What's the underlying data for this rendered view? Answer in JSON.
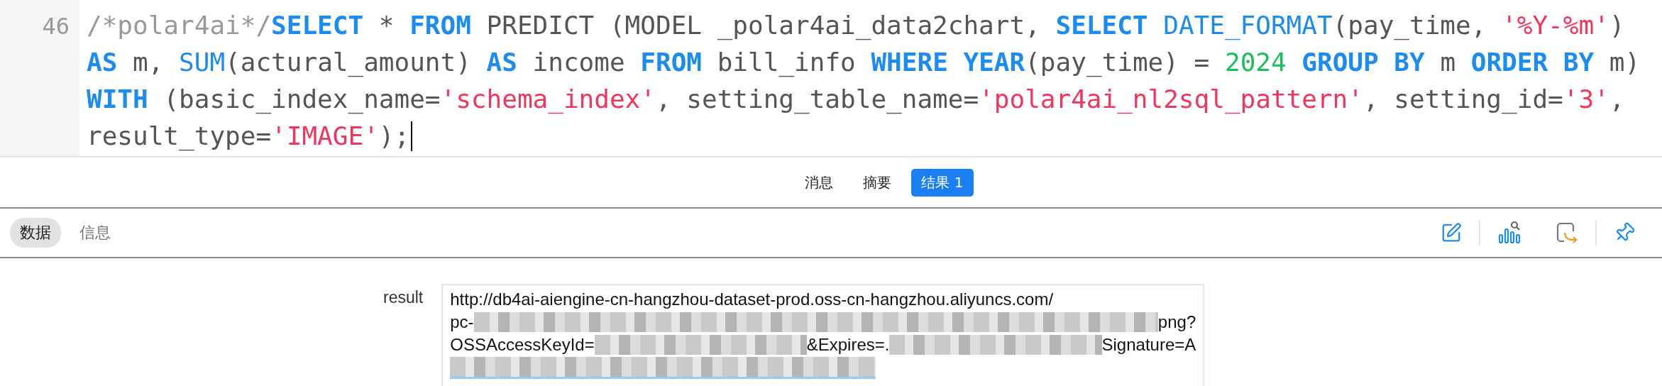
{
  "editor": {
    "line_number": "46",
    "lines": [
      [
        {
          "kind": "comment",
          "text": "/*polar4ai*/"
        },
        {
          "kind": "keyword",
          "text": "SELECT"
        },
        {
          "kind": "plain",
          "text": " * "
        },
        {
          "kind": "keyword",
          "text": "FROM"
        },
        {
          "kind": "plain",
          "text": " PREDICT (MODEL _polar4ai_data2chart, "
        },
        {
          "kind": "keyword",
          "text": "SELECT"
        },
        {
          "kind": "func",
          "text": " DATE_FORMAT"
        },
        {
          "kind": "plain",
          "text": "(pay_time, "
        },
        {
          "kind": "string",
          "text": "'%Y-%m'"
        },
        {
          "kind": "plain",
          "text": ")"
        }
      ],
      [
        {
          "kind": "keyword",
          "text": "AS"
        },
        {
          "kind": "plain",
          "text": " m, "
        },
        {
          "kind": "func",
          "text": "SUM"
        },
        {
          "kind": "plain",
          "text": "(actural_amount) "
        },
        {
          "kind": "keyword",
          "text": "AS"
        },
        {
          "kind": "plain",
          "text": " income "
        },
        {
          "kind": "keyword",
          "text": "FROM"
        },
        {
          "kind": "plain",
          "text": " bill_info "
        },
        {
          "kind": "keyword",
          "text": "WHERE YEAR"
        },
        {
          "kind": "plain",
          "text": "(pay_time) = "
        },
        {
          "kind": "number",
          "text": "2024"
        },
        {
          "kind": "keyword",
          "text": " GROUP BY"
        },
        {
          "kind": "plain",
          "text": " m "
        },
        {
          "kind": "keyword",
          "text": "ORDER BY"
        },
        {
          "kind": "plain",
          "text": " m)"
        }
      ],
      [
        {
          "kind": "keyword",
          "text": "WITH"
        },
        {
          "kind": "plain",
          "text": " (basic_index_name="
        },
        {
          "kind": "string",
          "text": "'schema_index'"
        },
        {
          "kind": "plain",
          "text": ", setting_table_name="
        },
        {
          "kind": "string",
          "text": "'polar4ai_nl2sql_pattern'"
        },
        {
          "kind": "plain",
          "text": ", setting_id="
        },
        {
          "kind": "string",
          "text": "'3'"
        },
        {
          "kind": "plain",
          "text": ","
        }
      ],
      [
        {
          "kind": "plain",
          "text": "result_type="
        },
        {
          "kind": "string",
          "text": "'IMAGE'"
        },
        {
          "kind": "plain",
          "text": ");"
        }
      ]
    ]
  },
  "result_tabs": [
    {
      "label": "消息",
      "selected": false
    },
    {
      "label": "摘要",
      "selected": false
    },
    {
      "label": "结果 1",
      "selected": true
    }
  ],
  "view_tabs": [
    {
      "label": "数据",
      "selected": true
    },
    {
      "label": "信息",
      "selected": false
    }
  ],
  "record": {
    "label": "result",
    "lines": [
      [
        {
          "kind": "text",
          "text": "http://db4ai-aiengine-cn-hangzhou-dataset-prod.oss-cn-hangzhou.aliyuncs.com/"
        }
      ],
      [
        {
          "kind": "text",
          "text": "pc-"
        },
        {
          "kind": "redacted"
        },
        {
          "kind": "text",
          "text": "png?"
        }
      ],
      [
        {
          "kind": "text",
          "text": "OSSAccessKeyId="
        },
        {
          "kind": "redacted"
        },
        {
          "kind": "text",
          "text": "&Expires=."
        },
        {
          "kind": "redacted"
        },
        {
          "kind": "text",
          "text": "Signature=A"
        }
      ],
      [
        {
          "kind": "redacted"
        }
      ]
    ]
  }
}
